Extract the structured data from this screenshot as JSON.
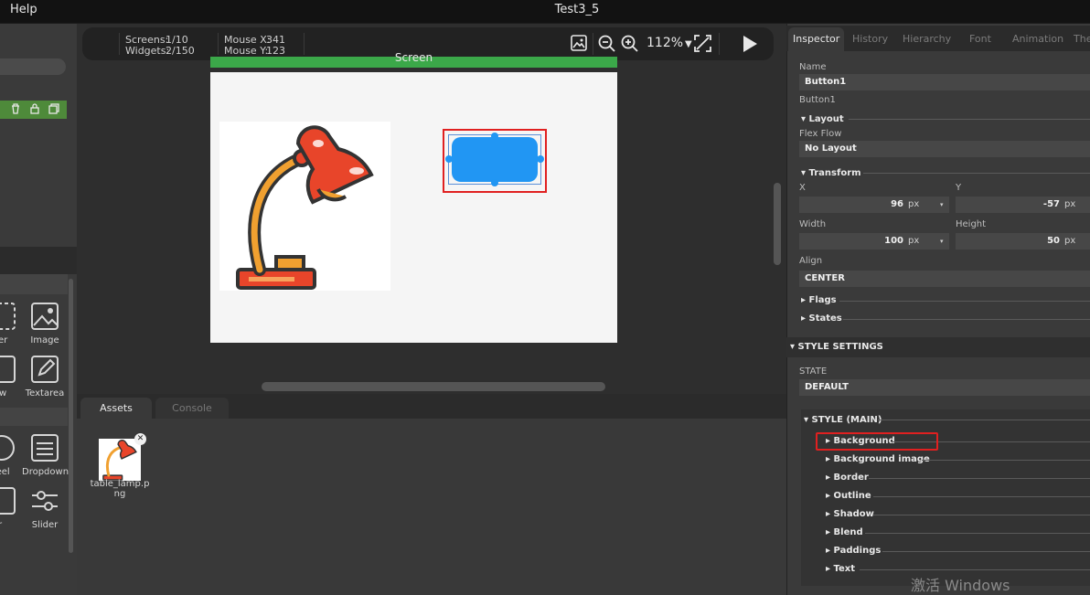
{
  "menu": {
    "help": "Help"
  },
  "window": {
    "title": "Test3_5"
  },
  "toolbar": {
    "screens_label": "Screens:",
    "screens_value": "1/10",
    "widgets_label": "Widgets:",
    "widgets_value": "2/150",
    "mouse_x_label": "Mouse X:",
    "mouse_x_value": "341",
    "mouse_y_label": "Mouse Y:",
    "mouse_y_value": "123",
    "zoom": "112%"
  },
  "canvas": {
    "screen_name": "Screen"
  },
  "widgets_panel": {
    "items": [
      {
        "label": "ner",
        "icon": "container-icon"
      },
      {
        "label": "Image",
        "icon": "image-icon"
      },
      {
        "label": "ew",
        "icon": "view-icon"
      },
      {
        "label": "Textarea",
        "icon": "textarea-icon"
      },
      {
        "label": "heel",
        "icon": "roller-icon"
      },
      {
        "label": "Dropdown",
        "icon": "dropdown-icon"
      },
      {
        "label": "r",
        "icon": "slider-partial-icon"
      },
      {
        "label": "Slider",
        "icon": "slider-icon"
      }
    ]
  },
  "bottom": {
    "tabs": [
      {
        "label": "Assets",
        "active": true
      },
      {
        "label": "Console",
        "active": false
      }
    ],
    "assets": [
      {
        "name": "table_lamp.png"
      }
    ]
  },
  "inspector": {
    "tabs": [
      "Inspector",
      "History",
      "Hierarchy",
      "Font",
      "Animation",
      "The"
    ],
    "name_label": "Name",
    "name_value": "Button1",
    "type_label": "Button1",
    "layout_section": "Layout",
    "flex_flow_label": "Flex Flow",
    "flex_flow_value": "No Layout",
    "transform_section": "Transform",
    "x_label": "X",
    "x_value": "96",
    "x_unit": "px",
    "y_label": "Y",
    "y_value": "-57",
    "y_unit": "px",
    "width_label": "Width",
    "width_value": "100",
    "width_unit": "px",
    "height_label": "Height",
    "height_value": "50",
    "height_unit": "px",
    "align_label": "Align",
    "align_value": "CENTER",
    "flags_section": "Flags",
    "states_section": "States",
    "style_settings": "STYLE SETTINGS",
    "state_label": "STATE",
    "state_value": "DEFAULT",
    "style_main": "STYLE (MAIN)",
    "style_props": [
      "Background",
      "Background image",
      "Border",
      "Outline",
      "Shadow",
      "Blend",
      "Paddings",
      "Text"
    ]
  },
  "colors": {
    "accent_green": "#3ba849",
    "button_blue": "#2196f3",
    "highlight_red": "#e02020"
  },
  "watermark": "激活 Windows"
}
